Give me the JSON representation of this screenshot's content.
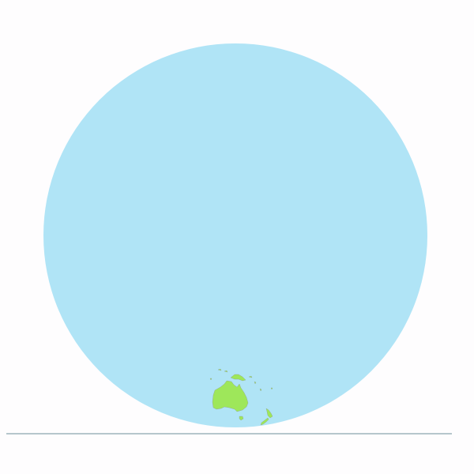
{
  "map": {
    "projection": "orthographic",
    "colors": {
      "background": "#fefdfe",
      "ocean": "#b0e4f6",
      "land": "#9ee75a",
      "land_stroke": "#8c8c8c",
      "ground_line": "#6d8f99"
    },
    "visible_regions": [
      "australia",
      "tasmania",
      "new-zealand-north-island",
      "new-zealand-south-island",
      "new-guinea",
      "pacific-islands"
    ]
  }
}
